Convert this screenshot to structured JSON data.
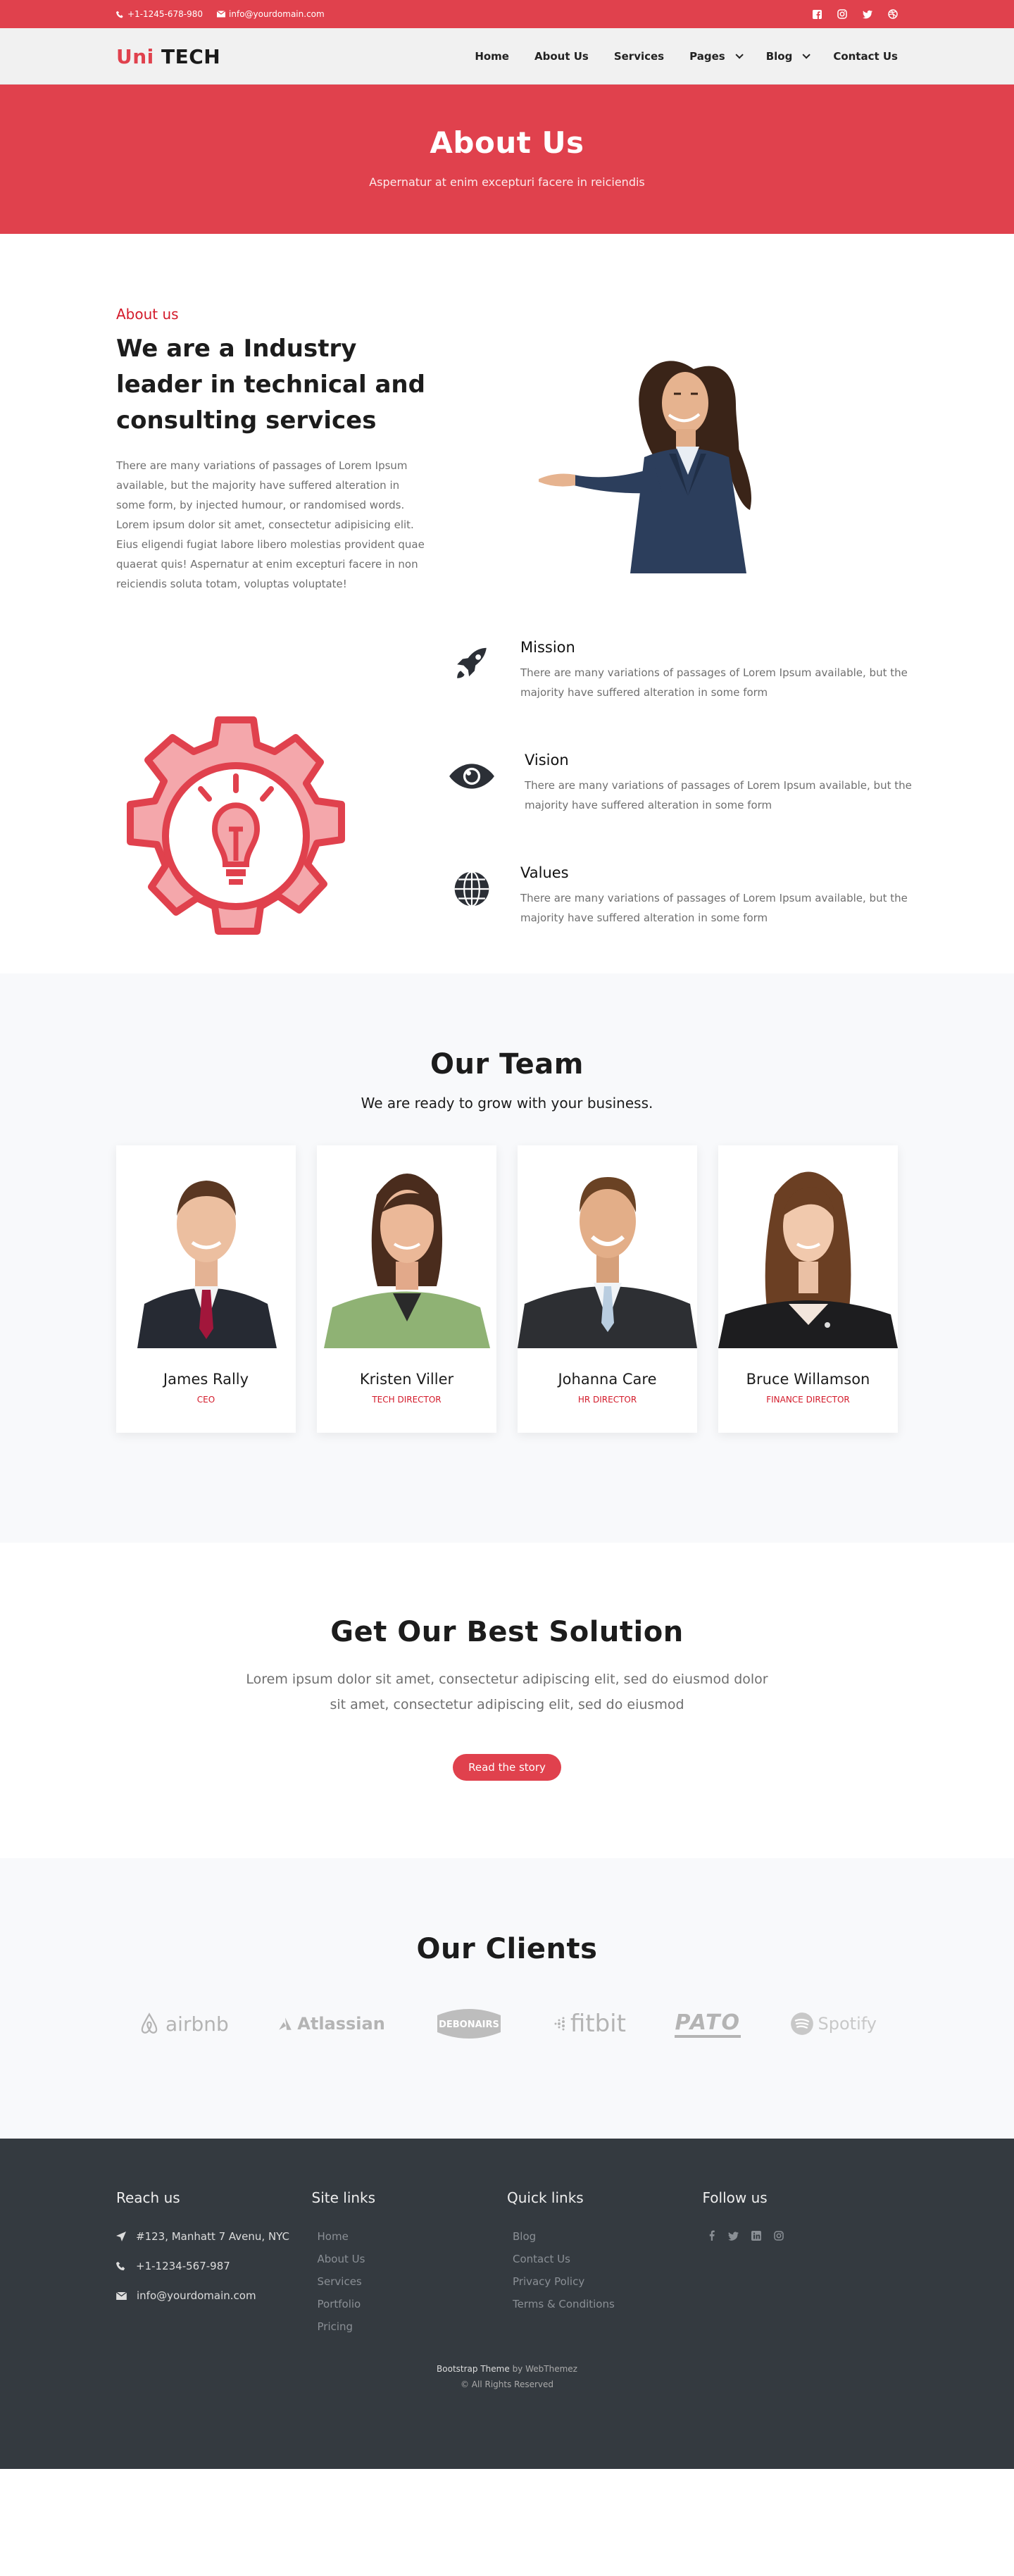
{
  "topbar": {
    "phone": "+1-1245-678-980",
    "email": "info@yourdomain.com",
    "social_icons": [
      "facebook-icon",
      "instagram-icon",
      "twitter-icon",
      "dribbble-icon"
    ]
  },
  "nav": {
    "logo_uni": "Uni",
    "logo_tech": "TECH",
    "items": [
      {
        "label": "Home"
      },
      {
        "label": "About Us"
      },
      {
        "label": "Services"
      },
      {
        "label": "Pages"
      },
      {
        "label": "Blog"
      },
      {
        "label": "Contact Us"
      }
    ]
  },
  "hero": {
    "title": "About Us",
    "subtitle": "Aspernatur at enim excepturi facere in reiciendis"
  },
  "about": {
    "label": "About us",
    "title": "We are a Industry leader in technical and consulting services",
    "body": "There are many variations of passages of Lorem Ipsum available, but the majority have suffered alteration in some form, by injected humour, or randomised words. Lorem ipsum dolor sit amet, consectetur adipisicing elit. Eius eligendi fugiat labore libero molestias provident quae quaerat quis! Aspernatur at enim excepturi facere in non reiciendis soluta totam, voluptas voluptate!"
  },
  "mvv": [
    {
      "title": "Mission",
      "text": "There are many variations of passages of Lorem Ipsum available, but the majority have suffered alteration in some form"
    },
    {
      "title": "Vision",
      "text": "There are many variations of passages of Lorem Ipsum available, but the majority have suffered alteration in some form"
    },
    {
      "title": "Values",
      "text": "There are many variations of passages of Lorem Ipsum available, but the majority have suffered alteration in some form"
    }
  ],
  "team": {
    "title": "Our Team",
    "subtitle": "We are ready to grow with your business.",
    "members": [
      {
        "name": "James Rally",
        "role": "CEO"
      },
      {
        "name": "Kristen Viller",
        "role": "TECH DIRECTOR"
      },
      {
        "name": "Johanna Care",
        "role": "HR DIRECTOR"
      },
      {
        "name": "Bruce Willamson",
        "role": "FINANCE DIRECTOR"
      }
    ]
  },
  "solution": {
    "title": "Get Our Best Solution",
    "text": "Lorem ipsum dolor sit amet, consectetur adipiscing elit, sed do eiusmod dolor sit amet, consectetur adipiscing elit, sed do eiusmod",
    "button": "Read the story"
  },
  "clients": {
    "title": "Our Clients",
    "logos": [
      "airbnb",
      "Atlassian",
      "DEBONAIRS",
      "fitbit",
      "PATO",
      "Spotify"
    ]
  },
  "footer": {
    "reach_title": "Reach us",
    "address": "#123, Manhatt 7 Avenu, NYC",
    "phone": "+1-1234-567-987",
    "email": "info@yourdomain.com",
    "site_title": "Site links",
    "site_links": [
      "Home",
      "About Us",
      "Services",
      "Portfolio",
      "Pricing"
    ],
    "quick_title": "Quick links",
    "quick_links": [
      "Blog",
      "Contact Us",
      "Privacy Policy",
      "Terms & Conditions"
    ],
    "follow_title": "Follow us",
    "follow_icons": [
      "facebook-icon",
      "twitter-icon",
      "linkedin-icon",
      "instagram-icon"
    ],
    "credit_theme": "Bootstrap Theme",
    "credit_by": "by WebThemez",
    "rights": "© All Rights Reserved"
  }
}
